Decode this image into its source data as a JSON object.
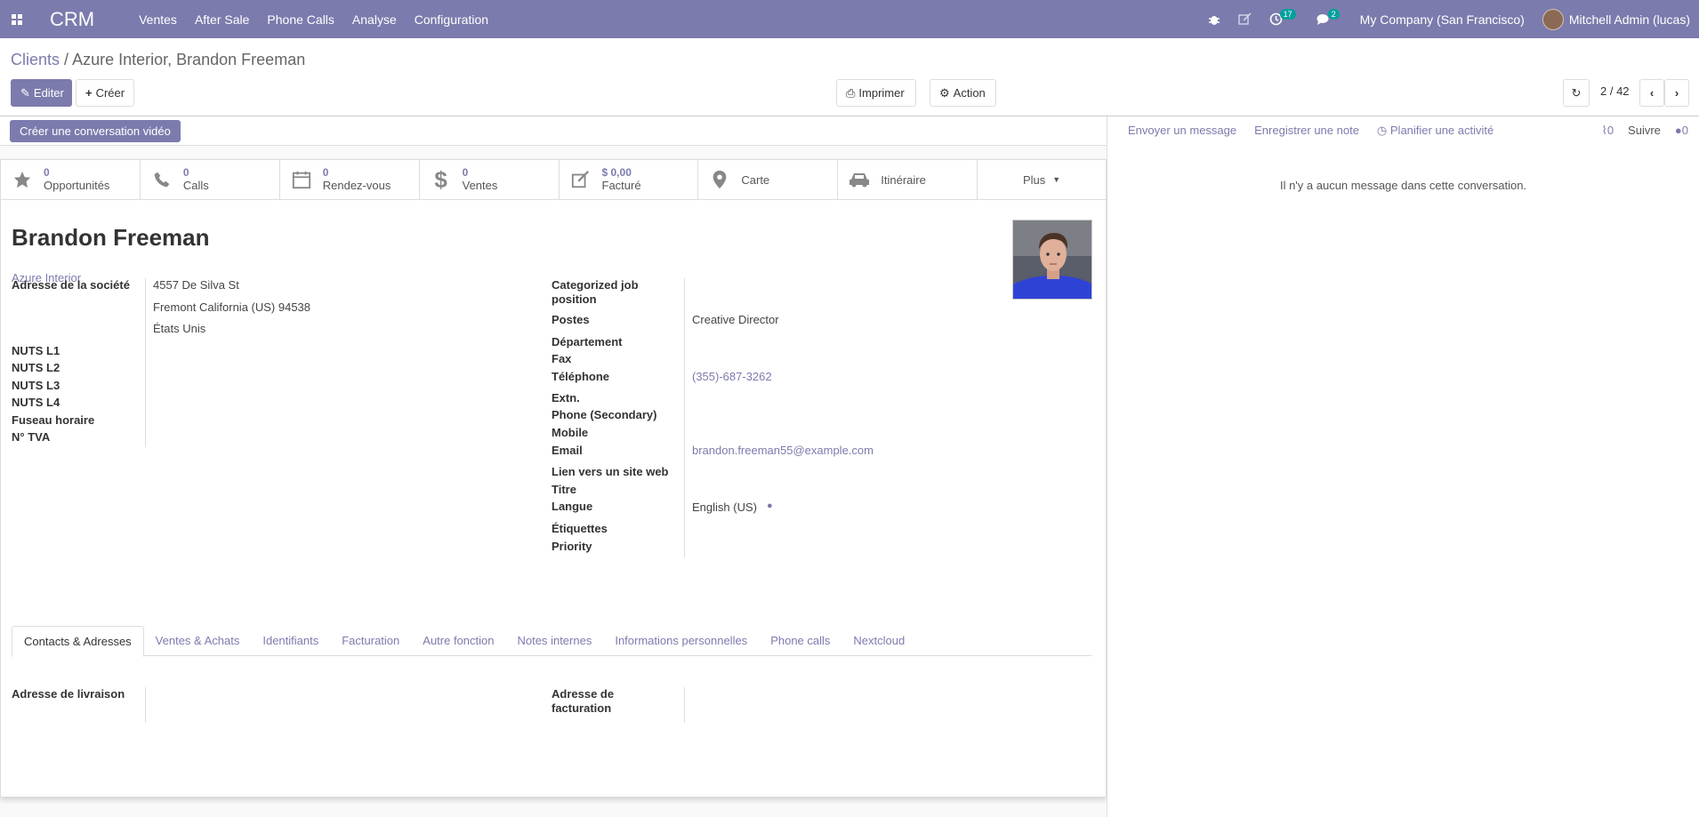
{
  "nav": {
    "app": "CRM",
    "menu": [
      "Ventes",
      "After Sale",
      "Phone Calls",
      "Analyse",
      "Configuration"
    ],
    "activity_count": "17",
    "message_count": "2",
    "company": "My Company (San Francisco)",
    "user": "Mitchell Admin (lucas)"
  },
  "breadcrumb": {
    "parent": "Clients",
    "sep": "/",
    "current": "Azure Interior, Brandon Freeman"
  },
  "buttons": {
    "edit": "Editer",
    "create": "Créer",
    "print": "Imprimer",
    "action": "Action",
    "video": "Créer une conversation vidéo"
  },
  "pager": "2 / 42",
  "stats": [
    {
      "value": "0",
      "label": "Opportunités",
      "icon": "star-icon"
    },
    {
      "value": "0",
      "label": "Calls",
      "icon": "phone-icon"
    },
    {
      "value": "0",
      "label": "Rendez-vous",
      "icon": "calendar-icon"
    },
    {
      "value": "0",
      "label": "Ventes",
      "icon": "dollar-icon"
    },
    {
      "value": "$ 0,00",
      "label": "Facturé",
      "icon": "edit-icon"
    },
    {
      "value": "",
      "label": "Carte",
      "icon": "map-marker-icon"
    },
    {
      "value": "",
      "label": "Itinéraire",
      "icon": "car-icon"
    },
    {
      "value": "",
      "label": "Plus",
      "icon": "caret-down-icon"
    }
  ],
  "partner": {
    "name": "Brandon Freeman",
    "company": "Azure Interior"
  },
  "left_fields": {
    "address_label": "Adresse de la société",
    "street": "4557 De Silva St",
    "city_line": "Fremont  California (US)  94538",
    "country": "États Unis",
    "nuts1": "NUTS L1",
    "nuts2": "NUTS L2",
    "nuts3": "NUTS L3",
    "nuts4": "NUTS L4",
    "tz": "Fuseau horaire",
    "vat": "N° TVA"
  },
  "right_fields": {
    "cat_job": "Categorized job position",
    "postes": "Postes",
    "postes_val": "Creative Director",
    "dept": "Département",
    "fax": "Fax",
    "phone": "Téléphone",
    "phone_val": "(355)-687-3262",
    "extn": "Extn.",
    "phone2": "Phone (Secondary)",
    "mobile": "Mobile",
    "email": "Email",
    "email_val": "brandon.freeman55@example.com",
    "website": "Lien vers un site web",
    "title": "Titre",
    "lang": "Langue",
    "lang_val": "English (US)",
    "tags": "Étiquettes",
    "priority": "Priority"
  },
  "tabs": [
    "Contacts & Adresses",
    "Ventes & Achats",
    "Identifiants",
    "Facturation",
    "Autre fonction",
    "Notes internes",
    "Informations personnelles",
    "Phone calls",
    "Nextcloud"
  ],
  "tab_content": {
    "delivery": "Adresse de livraison",
    "invoice": "Adresse de facturation"
  },
  "chatter": {
    "send": "Envoyer un message",
    "note": "Enregistrer une note",
    "schedule": "Planifier une activité",
    "attachments": "0",
    "follow": "Suivre",
    "followers": "0",
    "empty": "Il n'y a aucun message dans cette conversation."
  }
}
